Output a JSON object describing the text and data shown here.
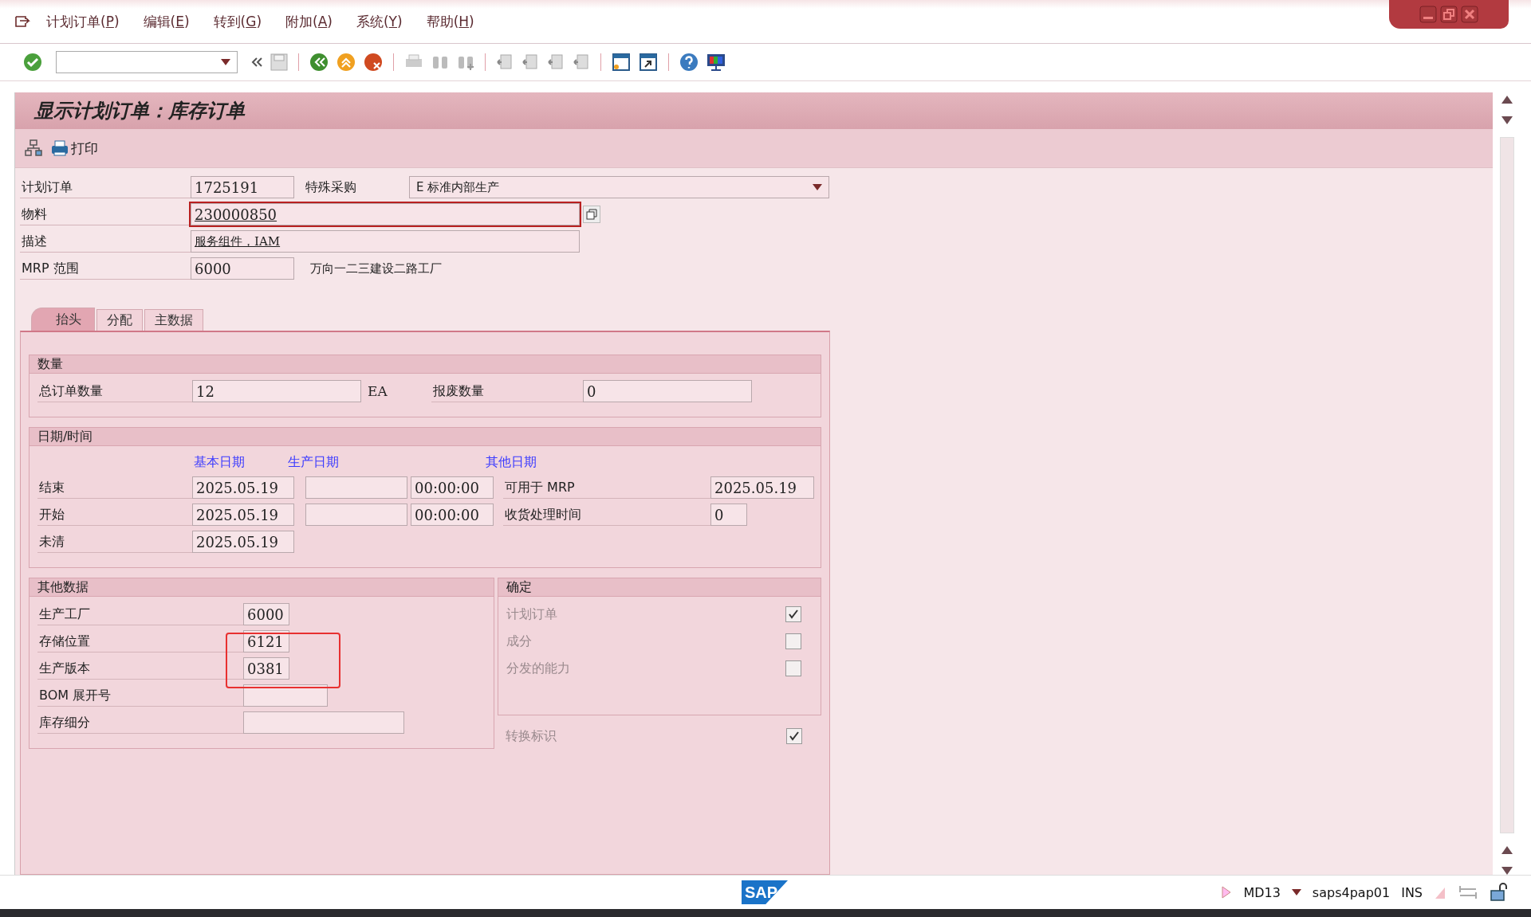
{
  "menu_bar": [
    {
      "prefix": "计划订单(",
      "key": "P",
      "suffix": ")"
    },
    {
      "prefix": "编辑(",
      "key": "E",
      "suffix": ")"
    },
    {
      "prefix": "转到(",
      "key": "G",
      "suffix": ")"
    },
    {
      "prefix": "附加(",
      "key": "A",
      "suffix": ")"
    },
    {
      "prefix": "系统(",
      "key": "Y",
      "suffix": ")"
    },
    {
      "prefix": "帮助(",
      "key": "H",
      "suffix": ")"
    }
  ],
  "title": "显示计划订单：库存订单",
  "app_toolbar": {
    "print_label": "打印"
  },
  "header": {
    "planned_order": {
      "label": "计划订单",
      "value": "1725191"
    },
    "special_procurement": {
      "label": "特殊采购",
      "value": "E 标准内部生产"
    },
    "material": {
      "label": "物料",
      "value": "230000850"
    },
    "description": {
      "label": "描述",
      "value": "服务组件，IAM"
    },
    "mrp_area": {
      "label": "MRP 范围",
      "value": "6000",
      "text": "万向一二三建设二路工厂"
    }
  },
  "tabs": [
    {
      "label": "抬头",
      "selected": true
    },
    {
      "label": "分配",
      "selected": false
    },
    {
      "label": "主数据",
      "selected": false
    }
  ],
  "quantity": {
    "title": "数量",
    "total": {
      "label": "总订单数量",
      "value": "12",
      "unit": "EA"
    },
    "scrap": {
      "label": "报废数量",
      "value": "0"
    }
  },
  "dates": {
    "title": "日期/时间",
    "column_headers": [
      "基本日期",
      "生产日期",
      "其他日期"
    ],
    "rows": [
      {
        "label": "结束",
        "basic": "2025.05.19",
        "prod_time": "00:00:00",
        "other_label": "可用于 MRP",
        "other_value": "2025.05.19"
      },
      {
        "label": "开始",
        "basic": "2025.05.19",
        "prod_time": "00:00:00",
        "other_label": "收货处理时间",
        "other_value": "0"
      },
      {
        "label": "未清",
        "basic": "2025.05.19"
      }
    ]
  },
  "other_data": {
    "title": "其他数据",
    "rows": [
      {
        "label": "生产工厂",
        "value": "6000"
      },
      {
        "label": "存储位置",
        "value": "6121"
      },
      {
        "label": "生产版本",
        "value": "0381"
      },
      {
        "label": "BOM 展开号"
      },
      {
        "label": "库存细分"
      }
    ]
  },
  "firm": {
    "title": "确定",
    "rows": [
      {
        "label": "计划订单",
        "checked": true
      },
      {
        "label": "成分",
        "checked": false
      },
      {
        "label": "分发的能力",
        "checked": false
      }
    ]
  },
  "conversion": {
    "label": "转换标识",
    "checked": true
  },
  "status_bar": {
    "logo": "SAP",
    "transaction": "MD13",
    "server": "saps4pap01",
    "mode": "INS"
  }
}
